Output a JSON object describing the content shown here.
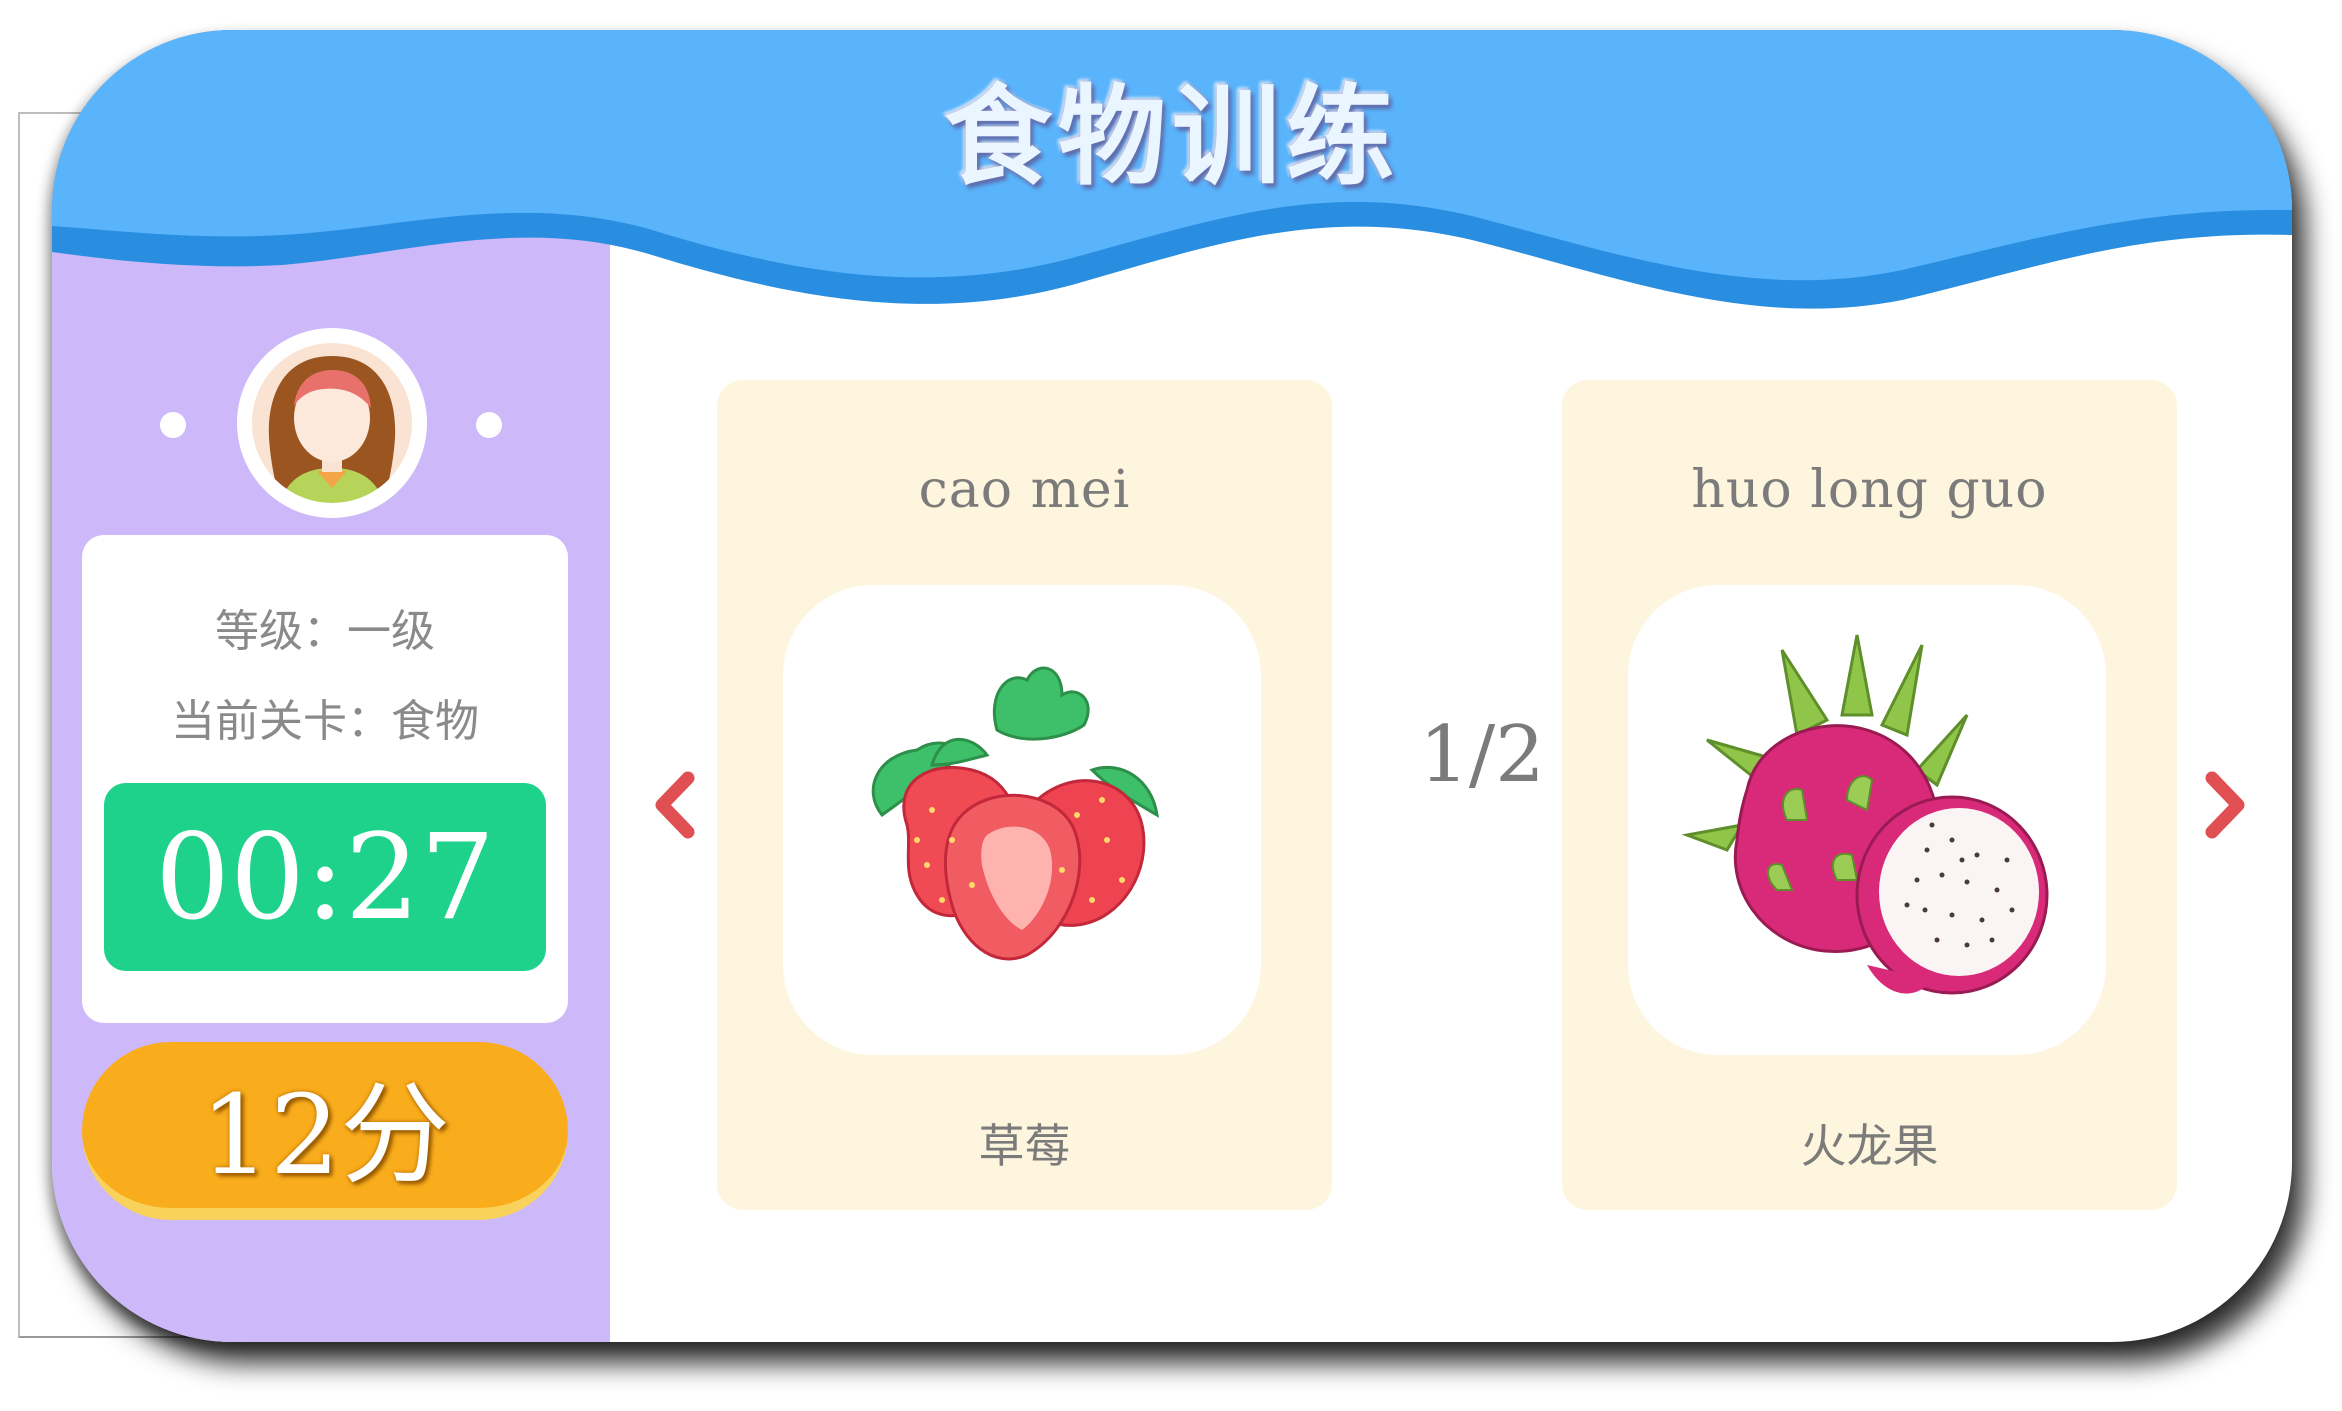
{
  "header": {
    "title": "食物训练"
  },
  "profile": {
    "level_text": "等级：一级",
    "stage_text": "当前关卡：食物",
    "timer": "00:27",
    "score": "12分"
  },
  "pager": {
    "indicator": "1/2"
  },
  "cards": [
    {
      "pinyin": "cao mei",
      "name": "草莓",
      "image": "strawberry"
    },
    {
      "pinyin": "huo long guo",
      "name": "火龙果",
      "image": "dragon-fruit"
    }
  ],
  "icons": {
    "prev": "chevron-left-icon",
    "next": "chevron-right-icon",
    "avatar": "girl-avatar"
  },
  "colors": {
    "header_blue": "#5ab4fb",
    "wave_dark": "#2a8ee0",
    "sidebar": "#cdb8fa",
    "timer_green": "#1ed28c",
    "score_orange": "#f9ad1c",
    "card_bg": "#fdf5dd",
    "arrow_red": "#e05052"
  }
}
